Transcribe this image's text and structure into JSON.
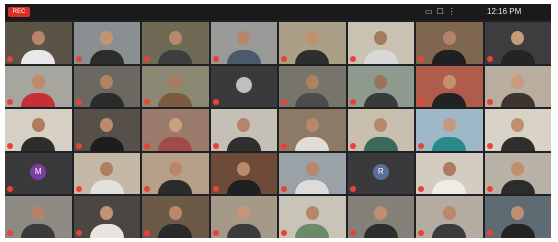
{
  "topbar": {
    "rec_label": "REC",
    "clock": "12:16 PM",
    "icons": [
      "grid-view-icon",
      "present-icon",
      "more-icon"
    ],
    "icon_glyphs": [
      "▭",
      "☐",
      "⋮"
    ]
  },
  "colors": {
    "background": "#202124",
    "mic_muted": "#ea4335",
    "recording": "#d93025"
  },
  "participants": [
    {
      "name": "",
      "bg": "#5b5346",
      "skin": "#b8856a",
      "shirt": "#e8e8e8",
      "kind": "video"
    },
    {
      "name": "",
      "bg": "#8a8f92",
      "skin": "#c39474",
      "shirt": "#2c2c2c",
      "kind": "video"
    },
    {
      "name": "",
      "bg": "#6f6a55",
      "skin": "#b48a6b",
      "shirt": "#3e3e3e",
      "kind": "video"
    },
    {
      "name": "",
      "bg": "#9a9a98",
      "skin": "#b58668",
      "shirt": "#4a5a6a",
      "kind": "video"
    },
    {
      "name": "",
      "bg": "#aa9e86",
      "skin": "#c09070",
      "shirt": "#2e2e2e",
      "kind": "video"
    },
    {
      "name": "",
      "bg": "#c9c2b3",
      "skin": "#a57a5e",
      "shirt": "#d8d8d8",
      "kind": "video"
    },
    {
      "name": "",
      "bg": "#7e6650",
      "skin": "#b3826a",
      "shirt": "#1f1f1f",
      "kind": "video"
    },
    {
      "name": "",
      "bg": "#3d3d40",
      "skin": "#c79a7a",
      "shirt": "#242424",
      "kind": "video"
    },
    {
      "name": "",
      "bg": "#a7a69e",
      "skin": "#c08a6c",
      "shirt": "#c62f36",
      "kind": "video"
    },
    {
      "name": "",
      "bg": "#6a6860",
      "skin": "#b38264",
      "shirt": "#2b2b2b",
      "kind": "video"
    },
    {
      "name": "",
      "bg": "#8b8874",
      "skin": "#a87b5c",
      "shirt": "#7b5c3e",
      "kind": "video"
    },
    {
      "name": "",
      "bg": "#3a3a3c",
      "skin": "#bfbfbf",
      "shirt": "#555555",
      "kind": "avatar",
      "initial": ""
    },
    {
      "name": "",
      "bg": "#77756c",
      "skin": "#b08060",
      "shirt": "#4c4c4c",
      "kind": "video"
    },
    {
      "name": "",
      "bg": "#8c9b8e",
      "skin": "#9b7358",
      "shirt": "#3a3a3a",
      "kind": "video"
    },
    {
      "name": "",
      "bg": "#b05c4c",
      "skin": "#c2906e",
      "shirt": "#222222",
      "kind": "video"
    },
    {
      "name": "",
      "bg": "#b9ada0",
      "skin": "#c99a7c",
      "shirt": "#3f3530",
      "kind": "video"
    },
    {
      "name": "",
      "bg": "#d6d0c4",
      "skin": "#b07c5e",
      "shirt": "#2d2d2d",
      "kind": "video"
    },
    {
      "name": "",
      "bg": "#57504a",
      "skin": "#bb8a6c",
      "shirt": "#1d1d1d",
      "kind": "video"
    },
    {
      "name": "",
      "bg": "#9a7a6a",
      "skin": "#caa080",
      "shirt": "#a04a4a",
      "kind": "video"
    },
    {
      "name": "",
      "bg": "#c5c0b6",
      "skin": "#b6846a",
      "shirt": "#2f2f2f",
      "kind": "video"
    },
    {
      "name": "",
      "bg": "#8a7a66",
      "skin": "#b9886a",
      "shirt": "#e0ddd6",
      "kind": "video"
    },
    {
      "name": "",
      "bg": "#c8bfae",
      "skin": "#b5896c",
      "shirt": "#3b6a5c",
      "kind": "video"
    },
    {
      "name": "",
      "bg": "#9fb8c8",
      "skin": "#c59a7e",
      "shirt": "#2a8a8a",
      "kind": "video"
    },
    {
      "name": "",
      "bg": "#d9d2c6",
      "skin": "#c0906e",
      "shirt": "#2e2e2e",
      "kind": "video"
    },
    {
      "name": "",
      "bg": "#3a3a3c",
      "skin": "#7b3fa0",
      "shirt": "#555555",
      "kind": "avatar",
      "initial": "M"
    },
    {
      "name": "",
      "bg": "#c4b9a6",
      "skin": "#ad7e60",
      "shirt": "#e4e0da",
      "kind": "video"
    },
    {
      "name": "",
      "bg": "#b7a08a",
      "skin": "#b88866",
      "shirt": "#2b2b2b",
      "kind": "video"
    },
    {
      "name": "",
      "bg": "#6e4a38",
      "skin": "#bb8a6a",
      "shirt": "#1f1f1f",
      "kind": "video"
    },
    {
      "name": "",
      "bg": "#9aa2a8",
      "skin": "#b8876a",
      "shirt": "#dcdcdc",
      "kind": "video"
    },
    {
      "name": "",
      "bg": "#3a3a3c",
      "skin": "#5a6e9a",
      "shirt": "#555555",
      "kind": "avatar",
      "initial": "R"
    },
    {
      "name": "",
      "bg": "#d4ccc0",
      "skin": "#ad7c5e",
      "shirt": "#efece6",
      "kind": "video"
    },
    {
      "name": "",
      "bg": "#b8b2a6",
      "skin": "#c0906e",
      "shirt": "#2c2c2c",
      "kind": "video"
    },
    {
      "name": "",
      "bg": "#8c8a82",
      "skin": "#b58466",
      "shirt": "#3a3a3a",
      "kind": "video"
    },
    {
      "name": "",
      "bg": "#4a4642",
      "skin": "#c29272",
      "shirt": "#e8e4de",
      "kind": "video"
    },
    {
      "name": "",
      "bg": "#6c5a48",
      "skin": "#b88868",
      "shirt": "#2a2a2a",
      "kind": "video"
    },
    {
      "name": "",
      "bg": "#a59a88",
      "skin": "#c6967a",
      "shirt": "#3c3c3c",
      "kind": "video"
    },
    {
      "name": "",
      "bg": "#c9c4b8",
      "skin": "#b6866a",
      "shirt": "#6a8a6a",
      "kind": "video"
    },
    {
      "name": "",
      "bg": "#858078",
      "skin": "#c08e70",
      "shirt": "#2e2e2e",
      "kind": "video"
    },
    {
      "name": "",
      "bg": "#b4aca0",
      "skin": "#b98a6c",
      "shirt": "#3b3b3b",
      "kind": "video"
    },
    {
      "name": "",
      "bg": "#5e6b72",
      "skin": "#bf8f6f",
      "shirt": "#242424",
      "kind": "video"
    }
  ]
}
